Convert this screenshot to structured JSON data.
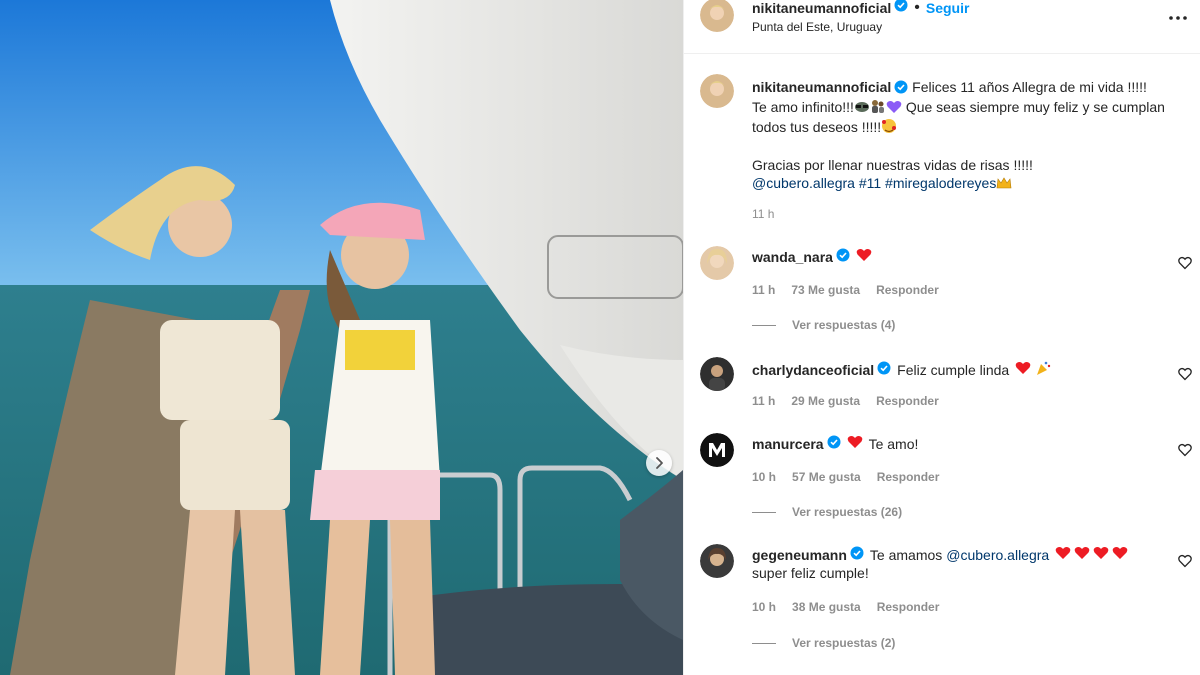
{
  "post": {
    "author": "nikitaneumannoficial",
    "follow_label": "Seguir",
    "location": "Punta del Este, Uruguay",
    "caption_line1": "Felices 11 años Allegra de mi vida !!!!!",
    "caption_line2a": "Te amo infinito!!!",
    "caption_line2b": "Que seas siempre muy feliz y se cumplan",
    "caption_line3": "todos tus deseos !!!!!",
    "caption_line4": "Gracias por llenar nuestras vidas de risas !!!!!",
    "caption_mention": "@cubero.allegra",
    "caption_tags": "#11 #miregalodereyes",
    "time": "11 h"
  },
  "comments": [
    {
      "user": "wanda_nara",
      "text": "",
      "time": "11 h",
      "likes": "73 Me gusta",
      "reply_label": "Responder",
      "replies": "Ver respuestas (4)"
    },
    {
      "user": "charlydanceoficial",
      "text": "Feliz cumple linda",
      "time": "11 h",
      "likes": "29 Me gusta",
      "reply_label": "Responder",
      "replies": ""
    },
    {
      "user": "manurcera",
      "text": "Te amo!",
      "time": "10 h",
      "likes": "57 Me gusta",
      "reply_label": "Responder",
      "replies": "Ver respuestas (26)"
    },
    {
      "user": "gegeneumann",
      "text_a": "Te amamos",
      "mention": "@cubero.allegra",
      "text_b": "super feliz cumple!",
      "time": "10 h",
      "likes": "38 Me gusta",
      "reply_label": "Responder",
      "replies": "Ver respuestas (2)"
    }
  ],
  "icons": {
    "verified": "verified-badge-icon",
    "more": "more-options-icon",
    "like": "heart-outline-icon",
    "next": "chevron-right-icon"
  },
  "colors": {
    "accent": "#0095f6",
    "verified": "#0095f6",
    "heart": "#ed1c24",
    "muted": "#8e8e8e",
    "link": "#00376b"
  }
}
